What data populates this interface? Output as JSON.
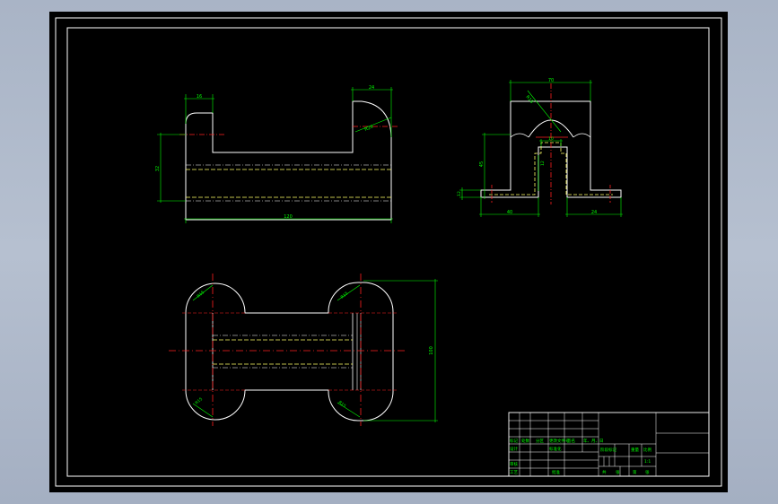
{
  "colors": {
    "background": "#000000",
    "frame": "#ffffff",
    "outline": "#ffffff",
    "hidden_line": "#ffff66",
    "center_line": "#ff2020",
    "dimension": "#00ff00",
    "title_block_text": "#00ff00"
  },
  "views": {
    "front": {
      "dims": {
        "top_left_width": "16",
        "top_right_width": "24",
        "left_height": "32",
        "radius": "R24",
        "total_length": "120"
      }
    },
    "side": {
      "dims": {
        "top_width": "70",
        "radius": "R18",
        "height": "45",
        "slot_width": "10",
        "slot_depth": "12",
        "base_height": "12",
        "left_base": "40",
        "right_base": "24"
      }
    },
    "top": {
      "dims": {
        "r_top_left": "R15",
        "r_top_right": "R15",
        "r_bottom_left": "R15",
        "r_bottom_right": "R15",
        "height": "100"
      }
    }
  },
  "title_block": {
    "row_labels": [
      "标记",
      "处数",
      "分区",
      "更改文件号",
      "签名",
      "年、月、日"
    ],
    "designer_label": "设计",
    "standard_label": "标准化",
    "review_label": "审核",
    "process_label": "工艺",
    "approve_label": "批准",
    "stage_label": "阶段标记",
    "weight_label": "重量",
    "scale_label": "比例",
    "scale_value": "1:1",
    "sheet_label": "共",
    "sheet_of_label": "张",
    "sheet_num_label": "第"
  }
}
